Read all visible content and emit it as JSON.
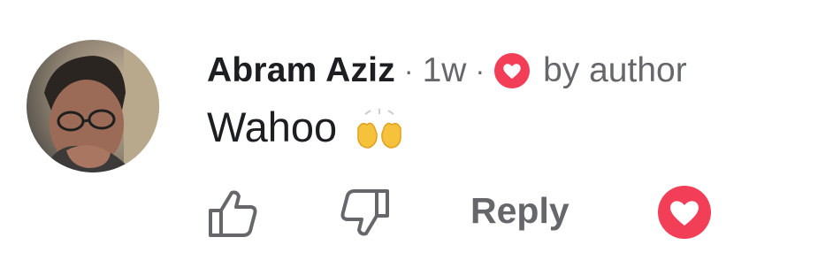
{
  "comment": {
    "author": "Abram Aziz",
    "separator": "·",
    "time": "1w",
    "author_like_label": "by author",
    "text": "Wahoo",
    "emoji": "raising-hands-emoji"
  },
  "actions": {
    "like_icon": "thumbs-up-icon",
    "dislike_icon": "thumbs-down-icon",
    "reply_label": "Reply",
    "heart_icon": "heart-icon"
  },
  "colors": {
    "primary_text": "#1c1e21",
    "secondary_text": "#65676b",
    "heart": "#f33e58"
  }
}
